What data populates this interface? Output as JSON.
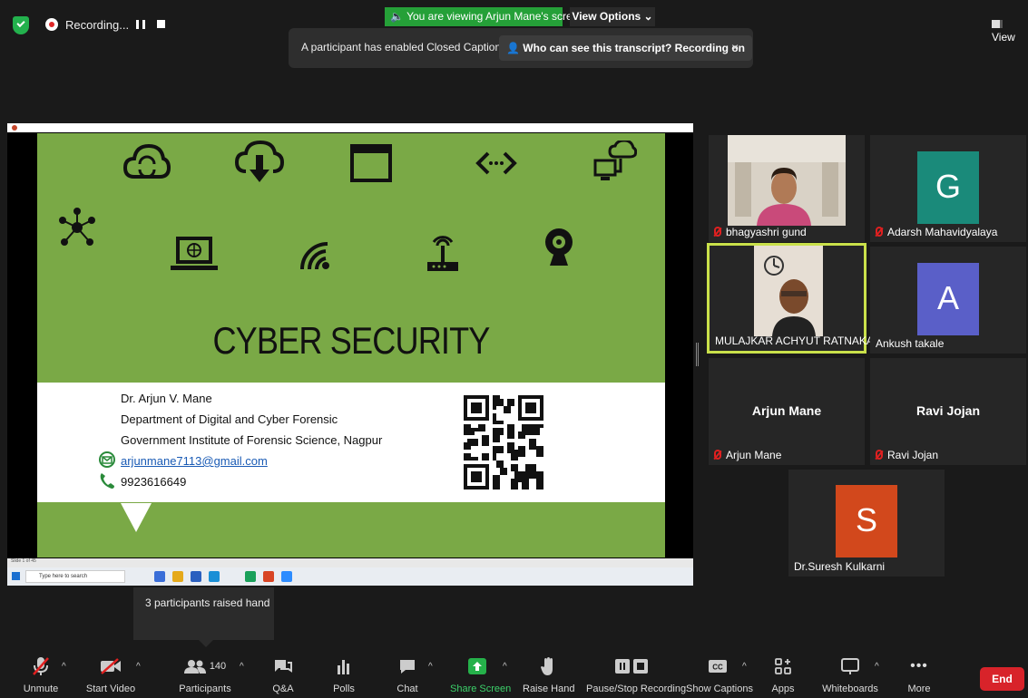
{
  "topbar": {
    "recording": "Recording...",
    "viewing_banner": "You are viewing Arjun Mane's screen",
    "view_options": "View Options",
    "view": "View"
  },
  "caption_bar": {
    "message": "A participant has enabled Closed Captioning",
    "who_can_see": "Who can see this transcript? Recording on",
    "close": "×"
  },
  "slide": {
    "title": "CYBER SECURITY",
    "author": "Dr. Arjun V. Mane",
    "department": "Department of Digital and Cyber Forensic",
    "institute": "Government Institute of Forensic Science, Nagpur",
    "email": "arjunmane7113@gmail.com",
    "phone": "9923616649",
    "slide_status": "Slide 1 of 45"
  },
  "taskbar": {
    "search_placeholder": "Type here to search"
  },
  "participants": [
    {
      "name": "bhagyashri gund",
      "muted": true
    },
    {
      "name": "Adarsh Mahavidyalaya",
      "muted": true,
      "initial": "G",
      "color": "#1a8a7a"
    },
    {
      "name": "MULAJKAR ACHYUT RATNAKAR...",
      "muted": false,
      "active": true
    },
    {
      "name": "Ankush takale",
      "muted": false,
      "initial": "A",
      "color": "#5a5fc8"
    },
    {
      "name": "Arjun Mane",
      "muted": true,
      "display": "Arjun Mane"
    },
    {
      "name": "Ravi Jojan",
      "muted": true,
      "display": "Ravi Jojan"
    },
    {
      "name": "Dr.Suresh Kulkarni",
      "muted": false,
      "initial": "S",
      "color": "#d2481c"
    }
  ],
  "toast": "3 participants raised hand",
  "toolbar": {
    "unmute": "Unmute",
    "start_video": "Start Video",
    "participants": "Participants",
    "participant_count": "140",
    "qa": "Q&A",
    "polls": "Polls",
    "chat": "Chat",
    "share_screen": "Share Screen",
    "raise_hand": "Raise Hand",
    "pause_stop": "Pause/Stop Recording",
    "show_captions": "Show Captions",
    "apps": "Apps",
    "whiteboards": "Whiteboards",
    "more": "More",
    "end": "End"
  },
  "colors": {
    "slide_green": "#7aa946",
    "share_green": "#25a038",
    "end_red": "#d8232a",
    "active_border": "#c9e04a"
  }
}
